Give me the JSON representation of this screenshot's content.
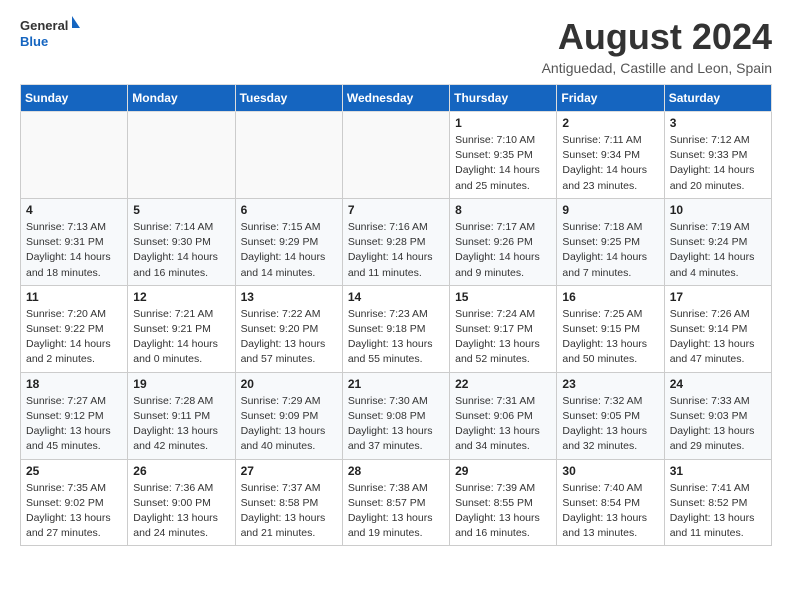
{
  "logo": {
    "general": "General",
    "blue": "Blue"
  },
  "title": "August 2024",
  "subtitle": "Antiguedad, Castille and Leon, Spain",
  "headers": [
    "Sunday",
    "Monday",
    "Tuesday",
    "Wednesday",
    "Thursday",
    "Friday",
    "Saturday"
  ],
  "weeks": [
    [
      {
        "day": "",
        "info": ""
      },
      {
        "day": "",
        "info": ""
      },
      {
        "day": "",
        "info": ""
      },
      {
        "day": "",
        "info": ""
      },
      {
        "day": "1",
        "info": "Sunrise: 7:10 AM\nSunset: 9:35 PM\nDaylight: 14 hours\nand 25 minutes."
      },
      {
        "day": "2",
        "info": "Sunrise: 7:11 AM\nSunset: 9:34 PM\nDaylight: 14 hours\nand 23 minutes."
      },
      {
        "day": "3",
        "info": "Sunrise: 7:12 AM\nSunset: 9:33 PM\nDaylight: 14 hours\nand 20 minutes."
      }
    ],
    [
      {
        "day": "4",
        "info": "Sunrise: 7:13 AM\nSunset: 9:31 PM\nDaylight: 14 hours\nand 18 minutes."
      },
      {
        "day": "5",
        "info": "Sunrise: 7:14 AM\nSunset: 9:30 PM\nDaylight: 14 hours\nand 16 minutes."
      },
      {
        "day": "6",
        "info": "Sunrise: 7:15 AM\nSunset: 9:29 PM\nDaylight: 14 hours\nand 14 minutes."
      },
      {
        "day": "7",
        "info": "Sunrise: 7:16 AM\nSunset: 9:28 PM\nDaylight: 14 hours\nand 11 minutes."
      },
      {
        "day": "8",
        "info": "Sunrise: 7:17 AM\nSunset: 9:26 PM\nDaylight: 14 hours\nand 9 minutes."
      },
      {
        "day": "9",
        "info": "Sunrise: 7:18 AM\nSunset: 9:25 PM\nDaylight: 14 hours\nand 7 minutes."
      },
      {
        "day": "10",
        "info": "Sunrise: 7:19 AM\nSunset: 9:24 PM\nDaylight: 14 hours\nand 4 minutes."
      }
    ],
    [
      {
        "day": "11",
        "info": "Sunrise: 7:20 AM\nSunset: 9:22 PM\nDaylight: 14 hours\nand 2 minutes."
      },
      {
        "day": "12",
        "info": "Sunrise: 7:21 AM\nSunset: 9:21 PM\nDaylight: 14 hours\nand 0 minutes."
      },
      {
        "day": "13",
        "info": "Sunrise: 7:22 AM\nSunset: 9:20 PM\nDaylight: 13 hours\nand 57 minutes."
      },
      {
        "day": "14",
        "info": "Sunrise: 7:23 AM\nSunset: 9:18 PM\nDaylight: 13 hours\nand 55 minutes."
      },
      {
        "day": "15",
        "info": "Sunrise: 7:24 AM\nSunset: 9:17 PM\nDaylight: 13 hours\nand 52 minutes."
      },
      {
        "day": "16",
        "info": "Sunrise: 7:25 AM\nSunset: 9:15 PM\nDaylight: 13 hours\nand 50 minutes."
      },
      {
        "day": "17",
        "info": "Sunrise: 7:26 AM\nSunset: 9:14 PM\nDaylight: 13 hours\nand 47 minutes."
      }
    ],
    [
      {
        "day": "18",
        "info": "Sunrise: 7:27 AM\nSunset: 9:12 PM\nDaylight: 13 hours\nand 45 minutes."
      },
      {
        "day": "19",
        "info": "Sunrise: 7:28 AM\nSunset: 9:11 PM\nDaylight: 13 hours\nand 42 minutes."
      },
      {
        "day": "20",
        "info": "Sunrise: 7:29 AM\nSunset: 9:09 PM\nDaylight: 13 hours\nand 40 minutes."
      },
      {
        "day": "21",
        "info": "Sunrise: 7:30 AM\nSunset: 9:08 PM\nDaylight: 13 hours\nand 37 minutes."
      },
      {
        "day": "22",
        "info": "Sunrise: 7:31 AM\nSunset: 9:06 PM\nDaylight: 13 hours\nand 34 minutes."
      },
      {
        "day": "23",
        "info": "Sunrise: 7:32 AM\nSunset: 9:05 PM\nDaylight: 13 hours\nand 32 minutes."
      },
      {
        "day": "24",
        "info": "Sunrise: 7:33 AM\nSunset: 9:03 PM\nDaylight: 13 hours\nand 29 minutes."
      }
    ],
    [
      {
        "day": "25",
        "info": "Sunrise: 7:35 AM\nSunset: 9:02 PM\nDaylight: 13 hours\nand 27 minutes."
      },
      {
        "day": "26",
        "info": "Sunrise: 7:36 AM\nSunset: 9:00 PM\nDaylight: 13 hours\nand 24 minutes."
      },
      {
        "day": "27",
        "info": "Sunrise: 7:37 AM\nSunset: 8:58 PM\nDaylight: 13 hours\nand 21 minutes."
      },
      {
        "day": "28",
        "info": "Sunrise: 7:38 AM\nSunset: 8:57 PM\nDaylight: 13 hours\nand 19 minutes."
      },
      {
        "day": "29",
        "info": "Sunrise: 7:39 AM\nSunset: 8:55 PM\nDaylight: 13 hours\nand 16 minutes."
      },
      {
        "day": "30",
        "info": "Sunrise: 7:40 AM\nSunset: 8:54 PM\nDaylight: 13 hours\nand 13 minutes."
      },
      {
        "day": "31",
        "info": "Sunrise: 7:41 AM\nSunset: 8:52 PM\nDaylight: 13 hours\nand 11 minutes."
      }
    ]
  ]
}
